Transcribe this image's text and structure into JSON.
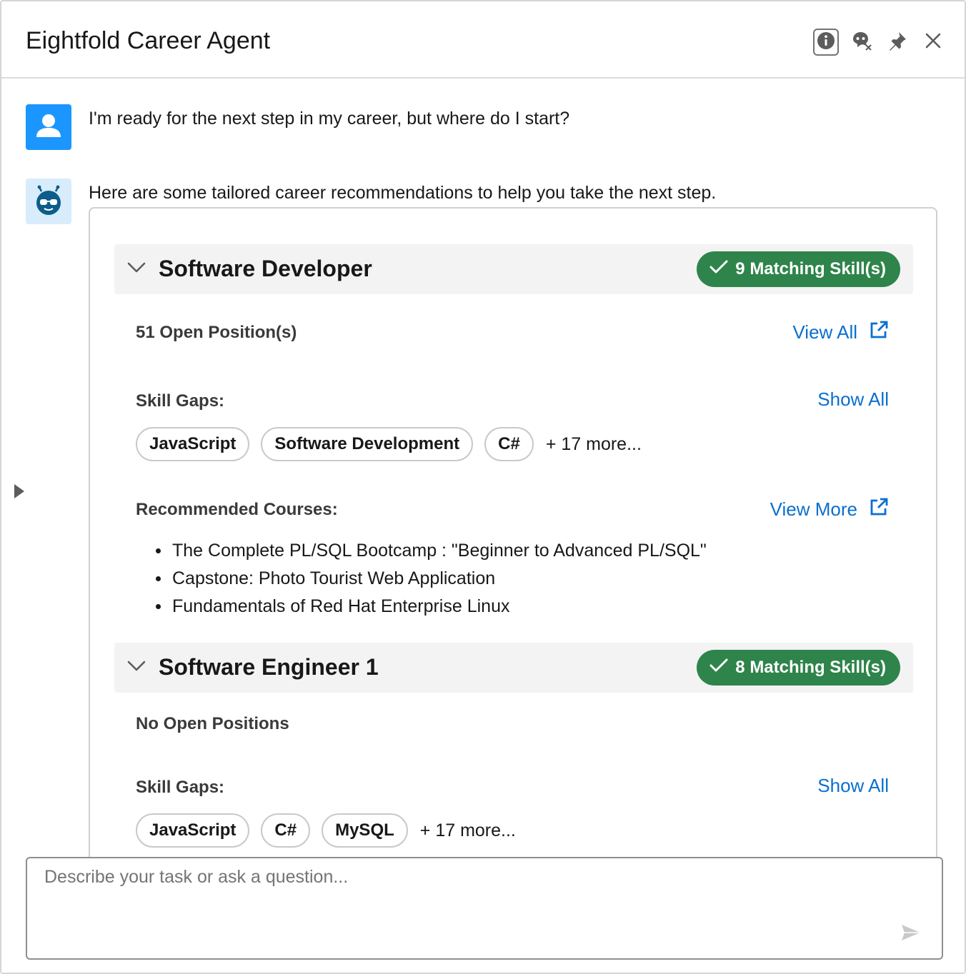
{
  "header": {
    "title": "Eightfold Career Agent",
    "icons": [
      "info-icon",
      "agent-off-icon",
      "pin-icon",
      "close-icon"
    ]
  },
  "messages": {
    "user_text": "I'm ready for the next step in my career, but where do I start?",
    "bot_text": "Here are some tailored career recommendations to help you take the next step."
  },
  "recommendations": [
    {
      "title": "Software Developer",
      "matching": "9 Matching Skill(s)",
      "positions": "51 Open Position(s)",
      "positions_link": "View All",
      "skill_gaps_label": "Skill Gaps:",
      "skill_gaps_link": "Show All",
      "skills": [
        "JavaScript",
        "Software Development",
        "C#"
      ],
      "skills_more": "+ 17 more...",
      "courses_label": "Recommended Courses:",
      "courses_link": "View More",
      "courses": [
        "The Complete PL/SQL Bootcamp : \"Beginner to Advanced PL/SQL\"",
        "Capstone: Photo Tourist Web Application",
        "Fundamentals of Red Hat Enterprise Linux"
      ]
    },
    {
      "title": "Software Engineer 1",
      "matching": "8 Matching Skill(s)",
      "positions": "No Open Positions",
      "skill_gaps_label": "Skill Gaps:",
      "skill_gaps_link": "Show All",
      "skills": [
        "JavaScript",
        "C#",
        "MySQL"
      ],
      "skills_more": "+ 17 more..."
    }
  ],
  "composer": {
    "placeholder": "Describe your task or ask a question..."
  },
  "colors": {
    "accent_blue": "#0b6fcf",
    "user_avatar": "#1b96ff",
    "match_green": "#2e844a"
  }
}
